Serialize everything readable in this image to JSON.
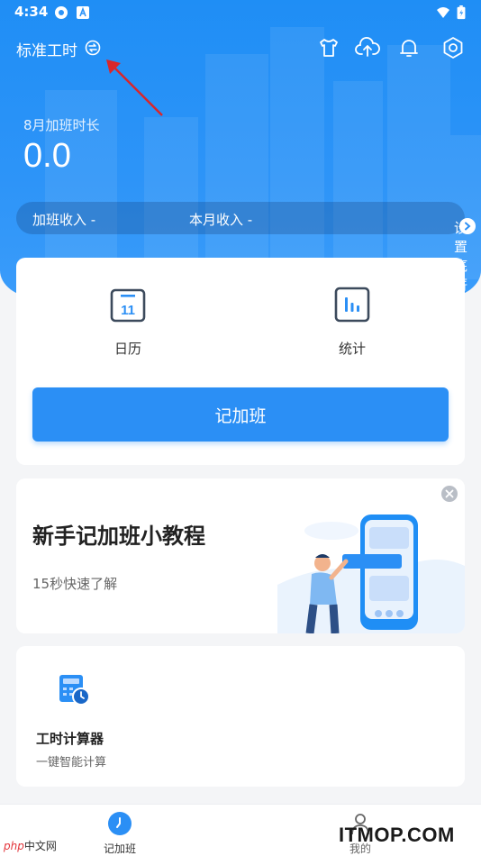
{
  "status_bar": {
    "time": "4:34"
  },
  "header": {
    "mode_title": "标准工时"
  },
  "summary": {
    "month_label": "8月加班时长",
    "month_value": "0.0",
    "overtime_income": "加班收入 -",
    "month_income": "本月收入 -",
    "set_salary": "设置底薪"
  },
  "quick_actions": [
    {
      "label": "日历",
      "icon": "calendar-icon",
      "badge": "11"
    },
    {
      "label": "统计",
      "icon": "stats-icon"
    }
  ],
  "record_button": "记加班",
  "tutorial": {
    "title": "新手记加班小教程",
    "subtitle": "15秒快速了解"
  },
  "tools": [
    {
      "name": "工时计算器",
      "desc": "一键智能计算",
      "icon": "calculator-clock-icon"
    }
  ],
  "bottom_nav": [
    {
      "label": "记加班",
      "icon": "clock-icon",
      "active": true
    },
    {
      "label": "我的",
      "icon": "person-icon",
      "active": false
    }
  ],
  "watermarks": {
    "left_brand": "php",
    "left_text": "中文网",
    "right": "ITMOP.COM"
  },
  "colors": {
    "primary": "#2b8ff5",
    "hero": "#1f8ef5",
    "annotation_arrow": "#d9262b"
  }
}
